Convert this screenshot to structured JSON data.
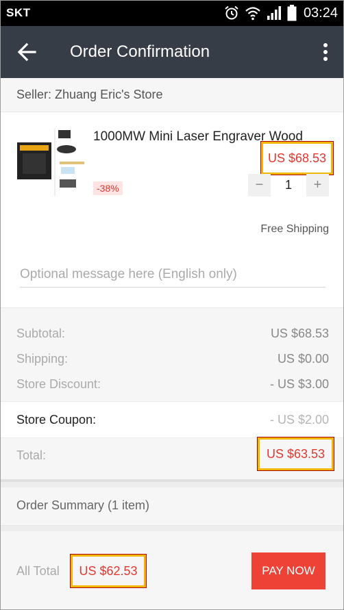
{
  "status_bar": {
    "carrier": "SKT",
    "time": "03:24",
    "icons": [
      "alarm-icon",
      "wifi-icon",
      "signal-icon",
      "battery-icon"
    ]
  },
  "app_bar": {
    "title": "Order Confirmation",
    "back_icon": "arrow-left-icon",
    "menu_icon": "more-vertical-icon"
  },
  "seller": {
    "label": "Seller:  Zhuang Eric's Store"
  },
  "product": {
    "title": "1000MW Mini Laser Engraver Wood",
    "price": "US $68.53",
    "discount": "-38%",
    "quantity": "1",
    "minus_label": "−",
    "plus_label": "+",
    "shipping": "Free Shipping",
    "message_placeholder": "Optional message here (English only)"
  },
  "totals": {
    "subtotal_label": "Subtotal:",
    "subtotal_value": "US $68.53",
    "shipping_label": "Shipping:",
    "shipping_value": "US $0.00",
    "store_discount_label": "Store Discount:",
    "store_discount_value": "- US $3.00",
    "store_coupon_label": "Store Coupon:",
    "store_coupon_value": "- US $2.00",
    "total_label": "Total:",
    "total_value": "US $63.53"
  },
  "summary": {
    "label": "Order Summary (1 item)"
  },
  "bottom": {
    "all_total_label": "All Total",
    "all_total_value": "US $62.53",
    "pay_label": "PAY NOW"
  },
  "colors": {
    "app_bar": "#363d46",
    "price_red": "#e3372f",
    "pay_button": "#ef4237",
    "highlight_box": "#f2b705"
  }
}
